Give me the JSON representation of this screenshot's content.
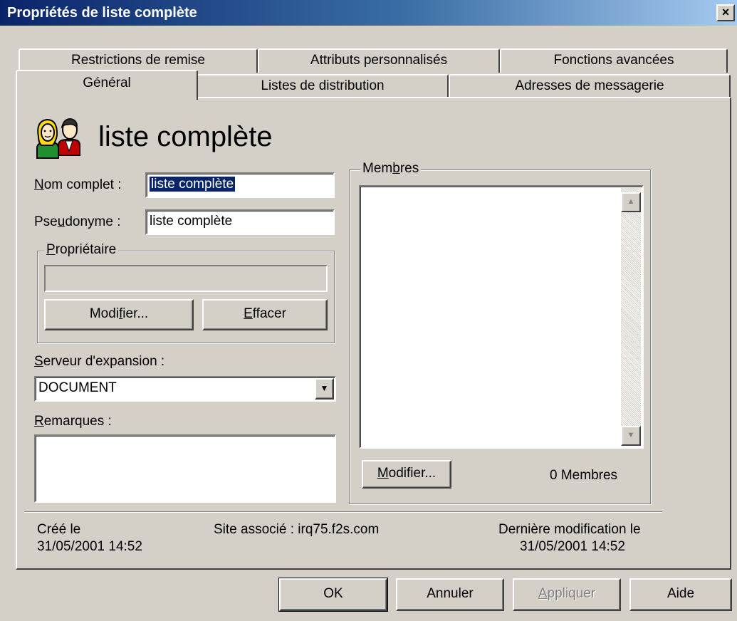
{
  "window": {
    "title": "Propriétés de liste complète",
    "close_glyph": "×"
  },
  "tabs_back": [
    {
      "label": "Restrictions de remise"
    },
    {
      "label": "Attributs personnalisés"
    },
    {
      "label": "Fonctions avancées"
    }
  ],
  "tabs_front": [
    {
      "label": "Général",
      "active": true
    },
    {
      "label": "Listes de distribution"
    },
    {
      "label": "Adresses de messagerie"
    }
  ],
  "header": {
    "icon": "people-icon",
    "title": "liste complète"
  },
  "form": {
    "nom_complet": {
      "label_pre": "",
      "label_key": "N",
      "label_post": "om complet :",
      "value": "liste complète"
    },
    "pseudonyme": {
      "label_pre": "Pse",
      "label_key": "u",
      "label_post": "donyme :",
      "value": "liste complète"
    },
    "proprietaire": {
      "group_label_pre": "",
      "group_label_key": "P",
      "group_label_post": "ropriétaire",
      "value": "",
      "modify_pre": "Modi",
      "modify_key": "f",
      "modify_post": "ier...",
      "clear_pre": "",
      "clear_key": "E",
      "clear_post": "ffacer"
    },
    "serveur": {
      "label_pre": "",
      "label_key": "S",
      "label_post": "erveur d'expansion :",
      "value": "DOCUMENT"
    },
    "remarques": {
      "label_pre": "",
      "label_key": "R",
      "label_post": "emarques :",
      "value": ""
    }
  },
  "membres": {
    "group_label_pre": "Mem",
    "group_label_key": "b",
    "group_label_post": "res",
    "modify_pre": "",
    "modify_key": "M",
    "modify_post": "odifier...",
    "count_text": "0 Membres"
  },
  "footer": {
    "cree_label": "Créé le",
    "cree_date": "31/05/2001  14:52",
    "site_text": "Site associé :  irq75.f2s.com",
    "modif_label": "Dernière modification le",
    "modif_date": "31/05/2001  14:52"
  },
  "buttons": {
    "ok": "OK",
    "annuler": "Annuler",
    "appliquer_pre": "",
    "appliquer_key": "A",
    "appliquer_post": "ppliquer",
    "aide": "Aide"
  },
  "colors": {
    "titlebar_start": "#0a246a",
    "titlebar_end": "#a6caf0",
    "face": "#d4d0c8",
    "selection": "#0a246a"
  }
}
